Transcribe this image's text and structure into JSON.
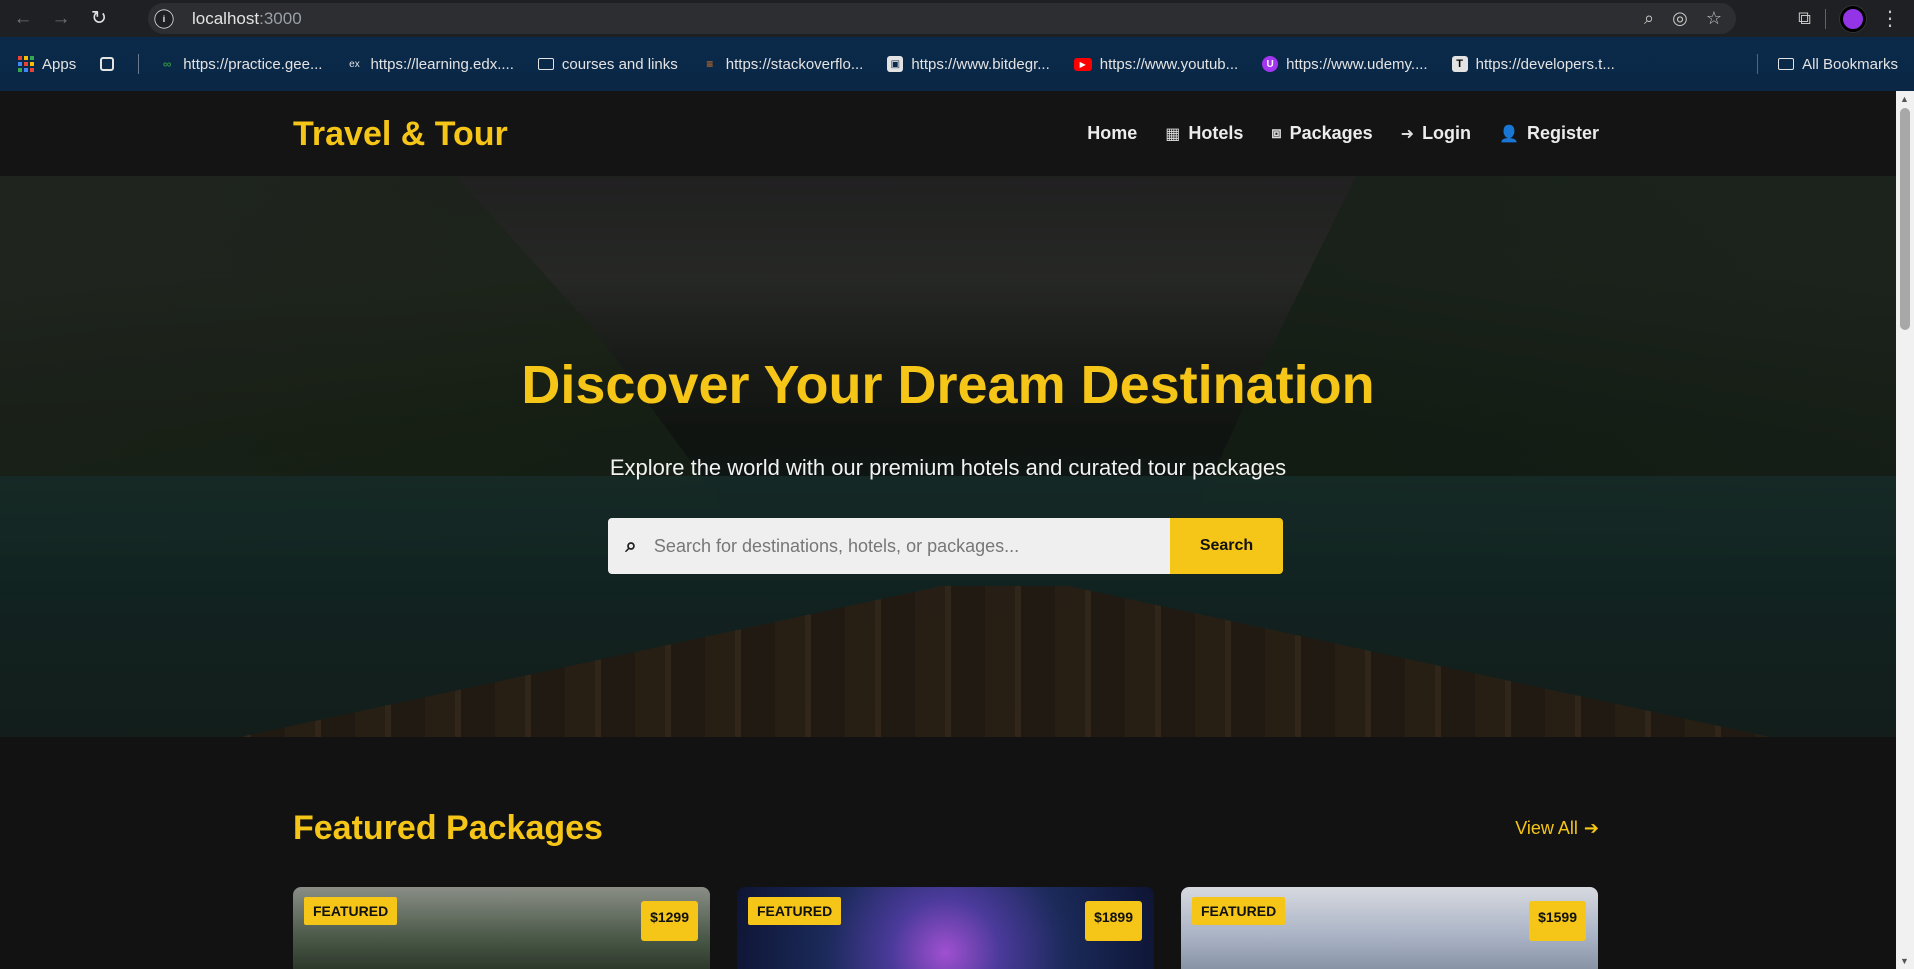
{
  "browser": {
    "url_host": "localhost",
    "url_port": ":3000",
    "bookmarks": [
      {
        "label": "Apps",
        "icon": "apps-icon"
      },
      {
        "label": "",
        "icon": "tab-groups-icon"
      },
      {
        "label": "https://practice.gee...",
        "icon": "geeksforgeeks-icon"
      },
      {
        "label": "https://learning.edx....",
        "icon": "edx-icon"
      },
      {
        "label": "courses and links",
        "icon": "folder-icon"
      },
      {
        "label": "https://stackoverflo...",
        "icon": "stackoverflow-icon"
      },
      {
        "label": "https://www.bitdegr...",
        "icon": "bitdegree-icon"
      },
      {
        "label": "https://www.youtub...",
        "icon": "youtube-icon"
      },
      {
        "label": "https://www.udemy....",
        "icon": "udemy-icon"
      },
      {
        "label": "https://developers.t...",
        "icon": "developers-icon"
      }
    ],
    "all_bookmarks": "All Bookmarks"
  },
  "site": {
    "logo": "Travel & Tour",
    "nav": {
      "home": "Home",
      "hotels": "Hotels",
      "packages": "Packages",
      "login": "Login",
      "register": "Register"
    },
    "hero": {
      "title": "Discover Your Dream Destination",
      "subtitle": "Explore the world with our premium hotels and curated tour packages",
      "search_placeholder": "Search for destinations, hotels, or packages...",
      "search_button": "Search"
    },
    "featured": {
      "title": "Featured Packages",
      "view_all": "View All",
      "cards": [
        {
          "badge": "FEATURED",
          "price": "$1299"
        },
        {
          "badge": "FEATURED",
          "price": "$1899"
        },
        {
          "badge": "FEATURED",
          "price": "$1599"
        }
      ]
    }
  },
  "colors": {
    "accent": "#f5c518",
    "page_bg": "#121212",
    "header_bg": "#141414",
    "bookmarks_bg": "#0b2a4a",
    "avatar": "#9334e6"
  }
}
